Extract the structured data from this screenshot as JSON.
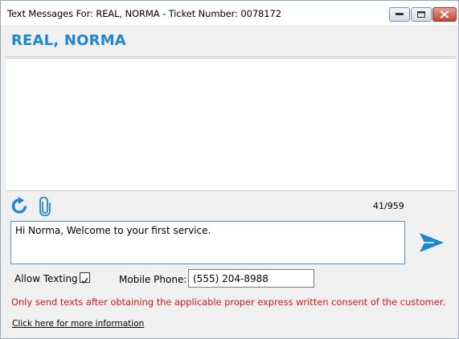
{
  "window": {
    "title": "Text Messages For: REAL, NORMA - Ticket Number: 0078172"
  },
  "header": {
    "customer_name": "REAL, NORMA"
  },
  "toolbar": {
    "refresh_icon": "refresh-icon",
    "attach_icon": "paperclip-icon",
    "char_count": "41/959"
  },
  "compose": {
    "message_value": "Hi Norma, Welcome to your first service.",
    "send_icon": "send-arrow-icon"
  },
  "settings": {
    "allow_texting_label": "Allow Texting",
    "allow_texting_checked": true,
    "mobile_phone_label": "Mobile Phone:",
    "mobile_phone_value": "(555) 204-8988"
  },
  "footer": {
    "consent_warning": "Only send texts after obtaining the applicable proper express written consent of the customer.",
    "info_link": "Click here for more information"
  },
  "colors": {
    "accent_blue": "#1f86d6",
    "warning_red": "#e01a1a"
  }
}
